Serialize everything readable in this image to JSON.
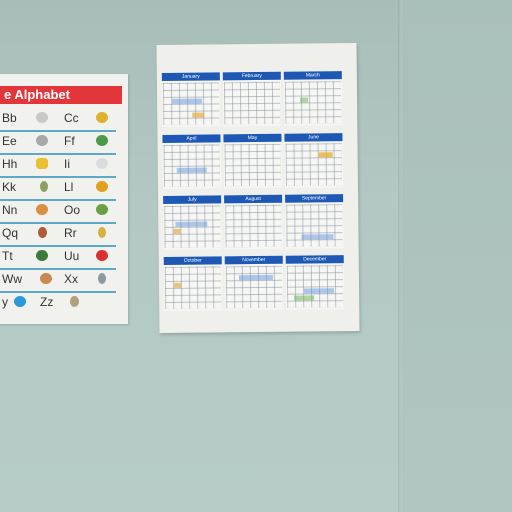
{
  "alphabet_poster": {
    "title": "e Alphabet",
    "rows": [
      {
        "left": "Bb",
        "right": "Cc"
      },
      {
        "left": "Ee",
        "right": "Ff"
      },
      {
        "left": "Hh",
        "right": "Ii"
      },
      {
        "left": "Kk",
        "right": "Ll"
      },
      {
        "left": "Nn",
        "right": "Oo"
      },
      {
        "left": "Qq",
        "right": "Rr"
      },
      {
        "left": "Tt",
        "right": "Uu"
      },
      {
        "left": "Ww",
        "right": "Xx"
      },
      {
        "left": "y",
        "right": "Zz"
      }
    ]
  },
  "calendar_poster": {
    "months": [
      {
        "name": "January"
      },
      {
        "name": "February"
      },
      {
        "name": "March"
      },
      {
        "name": "April"
      },
      {
        "name": "May"
      },
      {
        "name": "June"
      },
      {
        "name": "July"
      },
      {
        "name": "August"
      },
      {
        "name": "September"
      },
      {
        "name": "October"
      },
      {
        "name": "November"
      },
      {
        "name": "December"
      }
    ]
  },
  "colors": {
    "wall": "#b3c8c4",
    "month_header": "#1e58b5",
    "alphabet_header": "#e2363a",
    "rule_line": "#5fa9c8"
  }
}
